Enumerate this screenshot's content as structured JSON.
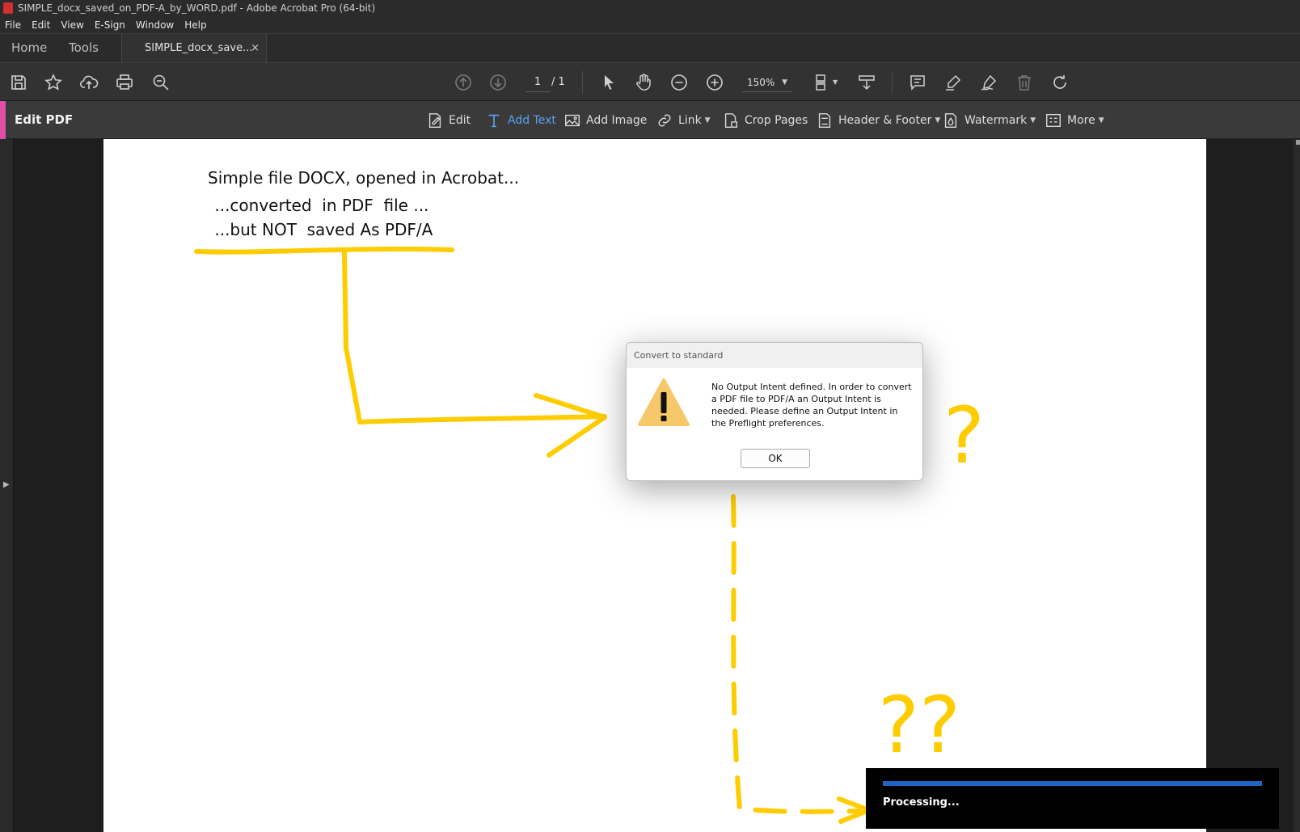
{
  "window": {
    "title": "SIMPLE_docx_saved_on_PDF-A_by_WORD.pdf - Adobe Acrobat Pro (64-bit)"
  },
  "menu": [
    "File",
    "Edit",
    "View",
    "E-Sign",
    "Window",
    "Help"
  ],
  "tabs": {
    "home": "Home",
    "tools": "Tools",
    "document": "SIMPLE_docx_save...",
    "close": "×"
  },
  "toolbar": {
    "page_current": "1",
    "page_total": "/ 1",
    "zoom": "150%"
  },
  "edit_bar": {
    "title": "Edit PDF",
    "tools": {
      "edit": "Edit",
      "add_text": "Add Text",
      "add_image": "Add Image",
      "link": "Link",
      "crop_pages": "Crop Pages",
      "header_footer": "Header & Footer",
      "watermark": "Watermark",
      "more": "More"
    },
    "accent_color": "#e04fa5",
    "active_color": "#5aa2f0"
  },
  "document": {
    "lines": [
      "Simple file DOCX, opened in Acrobat...",
      " ...converted  in PDF  file ...",
      " ...but NOT  saved As PDF/A"
    ],
    "annotations": {
      "question_1": "?",
      "question_2": "??"
    },
    "annotation_color": "#ffcc00"
  },
  "dialog": {
    "title": "Convert to standard",
    "message": "No Output Intent defined. In order to convert a PDF file to PDF/A an Output Intent is needed. Please define an Output Intent in the Preflight preferences.",
    "ok_label": "OK"
  },
  "processing": {
    "label": "Processing...",
    "progress_color": "#1f64c0"
  }
}
